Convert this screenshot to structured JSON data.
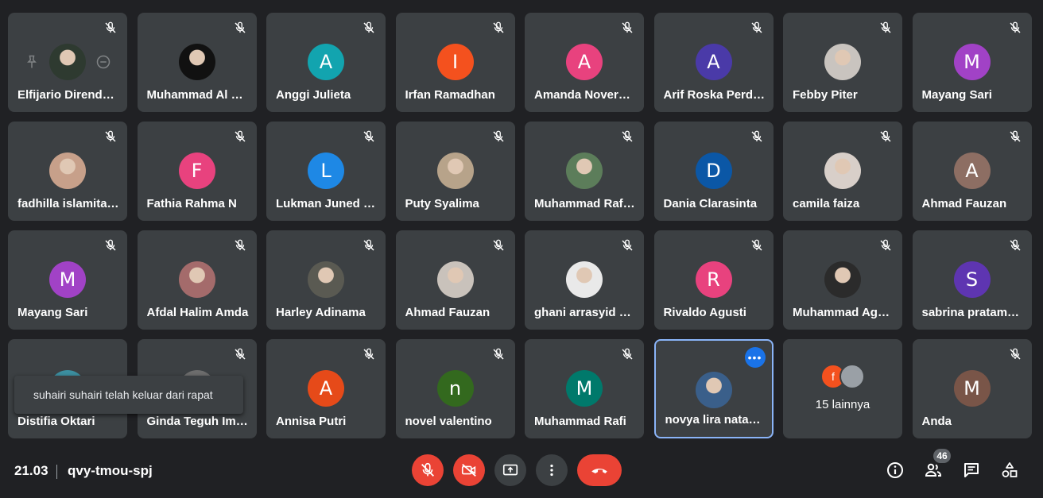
{
  "colors": {
    "background": "#202124",
    "tile": "#3c4043",
    "active_border": "#8ab4f8",
    "danger": "#ea4335",
    "accent": "#1a73e8"
  },
  "tiles": [
    {
      "name": "Elfijario Direnda…",
      "avatar": "photo",
      "photo_color": "#2e3a30",
      "muted": true,
      "pinned_controls": true
    },
    {
      "name": "Muhammad Al …",
      "avatar": "photo",
      "photo_color": "#111111",
      "muted": true
    },
    {
      "name": "Anggi Julieta",
      "avatar": "A",
      "color": "#12a4af",
      "muted": true
    },
    {
      "name": "Irfan Ramadhan",
      "avatar": "I",
      "color": "#f4511e",
      "muted": true
    },
    {
      "name": "Amanda Noverd…",
      "avatar": "A",
      "color": "#e8427e",
      "muted": true
    },
    {
      "name": "Arif Roska Perd…",
      "avatar": "A",
      "color": "#4a3aa8",
      "muted": true
    },
    {
      "name": "Febby Piter",
      "avatar": "photo",
      "photo_color": "#c9c4bf",
      "muted": true
    },
    {
      "name": "Mayang Sari",
      "avatar": "M",
      "color": "#a142c6",
      "muted": true
    },
    {
      "name": "fadhilla islamita …",
      "avatar": "photo",
      "photo_color": "#c7a08a",
      "muted": true
    },
    {
      "name": "Fathia Rahma N",
      "avatar": "F",
      "color": "#e8427e",
      "muted": true
    },
    {
      "name": "Lukman Juned …",
      "avatar": "L",
      "color": "#1e88e5",
      "muted": true
    },
    {
      "name": "Puty Syalima",
      "avatar": "photo",
      "photo_color": "#b7a38a",
      "muted": true
    },
    {
      "name": "Muhammad Raf…",
      "avatar": "photo",
      "photo_color": "#5c7d5a",
      "muted": true
    },
    {
      "name": "Dania Clarasinta",
      "avatar": "D",
      "color": "#0b57a6",
      "muted": true
    },
    {
      "name": "camila faiza",
      "avatar": "photo",
      "photo_color": "#d8cfc9",
      "muted": true
    },
    {
      "name": "Ahmad Fauzan",
      "avatar": "A",
      "color": "#8d6e63",
      "muted": true
    },
    {
      "name": "Mayang Sari",
      "avatar": "M",
      "color": "#a142c6",
      "muted": true
    },
    {
      "name": "Afdal Halim Amda",
      "avatar": "photo",
      "photo_color": "#a46b6b",
      "muted": true
    },
    {
      "name": "Harley Adinama",
      "avatar": "photo",
      "photo_color": "#5a5a52",
      "muted": true
    },
    {
      "name": "Ahmad Fauzan",
      "avatar": "photo",
      "photo_color": "#c9c2bb",
      "muted": true
    },
    {
      "name": "ghani arrasyid z…",
      "avatar": "photo",
      "photo_color": "#e9e9e9",
      "muted": true
    },
    {
      "name": "Rivaldo Agusti",
      "avatar": "R",
      "color": "#e8427e",
      "muted": true
    },
    {
      "name": "Muhammad Ag…",
      "avatar": "photo",
      "photo_color": "#2b2b2b",
      "muted": true
    },
    {
      "name": "sabrina pratam…",
      "avatar": "S",
      "color": "#5e35b1",
      "muted": true
    },
    {
      "name": "Distifia Oktari",
      "avatar": "photo",
      "photo_color": "#3c8fa1",
      "muted": false
    },
    {
      "name": "Ginda Teguh Im…",
      "avatar": "photo",
      "photo_color": "#6d6d6d",
      "muted": true
    },
    {
      "name": "Annisa Putri",
      "avatar": "A",
      "color": "#e64a19",
      "muted": true
    },
    {
      "name": "novel valentino",
      "avatar": "n",
      "color": "#33691e",
      "muted": true
    },
    {
      "name": "Muhammad Rafi",
      "avatar": "M",
      "color": "#00796b",
      "muted": true
    },
    {
      "name": "novya lira natas…",
      "avatar": "photo",
      "photo_color": "#3a5f8a",
      "muted": false,
      "active": true
    },
    {
      "name": "",
      "others": true,
      "others_label": "15 lainnya",
      "others_initial": "f",
      "others_color": "#f4511e"
    },
    {
      "name": "Anda",
      "avatar": "M",
      "color": "#795548",
      "muted": true
    }
  ],
  "toast": {
    "text": "suhairi suhairi telah keluar dari rapat"
  },
  "meeting": {
    "time": "21.03",
    "code": "qvy-tmou-spj"
  },
  "controls": {
    "participants_count": "46"
  },
  "icons": [
    "mic-off-icon",
    "camera-off-icon",
    "present-icon",
    "more-vert-icon",
    "hangup-icon",
    "info-icon",
    "people-icon",
    "chat-icon",
    "activities-icon",
    "pin-icon",
    "remove-icon",
    "more-horiz-icon"
  ]
}
